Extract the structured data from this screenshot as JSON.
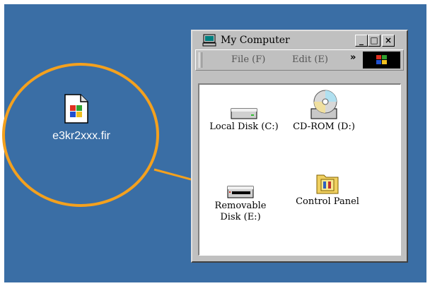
{
  "file": {
    "name": "e3kr2xxx.fir"
  },
  "window": {
    "title": "My Computer",
    "controls": {
      "minimize": "_",
      "maximize": "□",
      "close": "×"
    },
    "menu": {
      "file": "File",
      "file_key": "(F)",
      "edit": "Edit",
      "edit_key": "(E)",
      "more": "»"
    },
    "items": [
      {
        "label": "Local Disk (C:)",
        "icon": "hard-drive-icon"
      },
      {
        "label": "CD-ROM (D:)",
        "icon": "cd-rom-icon"
      },
      {
        "label_line1": "Removable",
        "label_line2": "Disk (E:)",
        "icon": "removable-disk-icon"
      },
      {
        "label": "Control Panel",
        "icon": "control-panel-icon"
      }
    ]
  },
  "colors": {
    "desktop": "#3a6ea5",
    "highlight": "#f4a11e",
    "window": "#c0c0c0"
  }
}
